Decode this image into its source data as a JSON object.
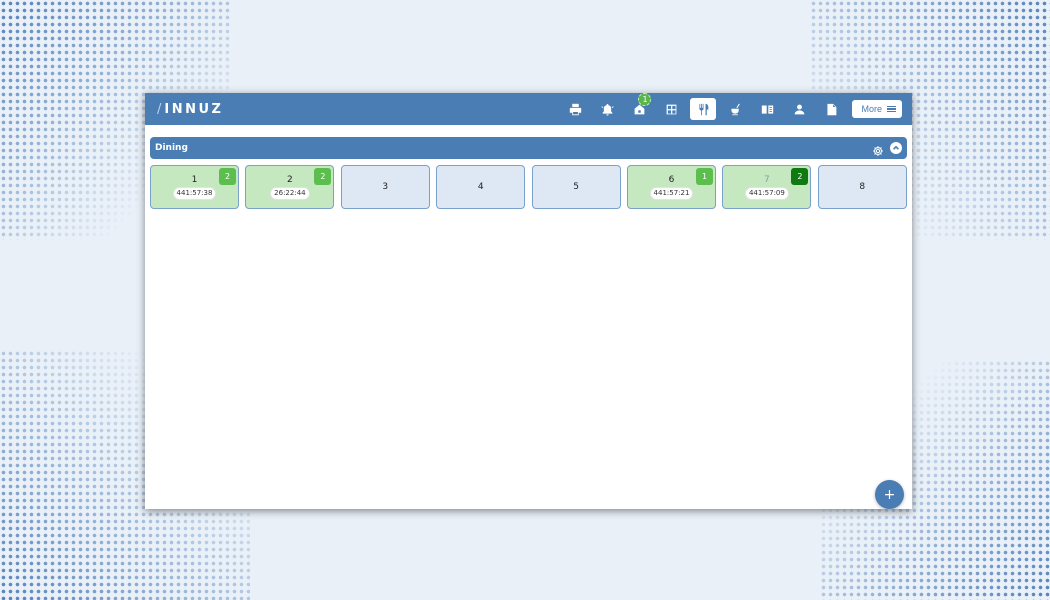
{
  "app": {
    "logo_text": "INNUZ",
    "logo_mark": "/"
  },
  "toolbar": {
    "buttons": [
      {
        "name": "printer-icon"
      },
      {
        "name": "alarm-bell-icon"
      },
      {
        "name": "house-icon",
        "badge": "1"
      },
      {
        "name": "grid-icon"
      },
      {
        "name": "fork-knife-icon",
        "active": true
      },
      {
        "name": "takeaway-icon"
      },
      {
        "name": "menu-book-icon"
      },
      {
        "name": "user-icon"
      },
      {
        "name": "document-icon"
      }
    ],
    "more_label": "More"
  },
  "section": {
    "title": "Dining"
  },
  "tables": [
    {
      "number": "1",
      "time": "441:57:38",
      "badge": "2",
      "badge_style": "light",
      "occupied": true
    },
    {
      "number": "2",
      "time": "26:22:44",
      "badge": "2",
      "badge_style": "light",
      "occupied": true
    },
    {
      "number": "3",
      "occupied": false
    },
    {
      "number": "4",
      "occupied": false
    },
    {
      "number": "5",
      "occupied": false
    },
    {
      "number": "6",
      "time": "441:57:21",
      "badge": "1",
      "badge_style": "light",
      "occupied": true
    },
    {
      "number": "7",
      "time": "441:57:09",
      "badge": "2",
      "badge_style": "dark",
      "occupied": true,
      "dim": true
    },
    {
      "number": "8",
      "occupied": false
    }
  ],
  "fab_label": "+",
  "colors": {
    "primary": "#4a7db3",
    "occupied": "#c6e8c0",
    "free": "#dde8f4",
    "badge": "#5cbe4e",
    "badge_dark": "#0f7a11"
  }
}
